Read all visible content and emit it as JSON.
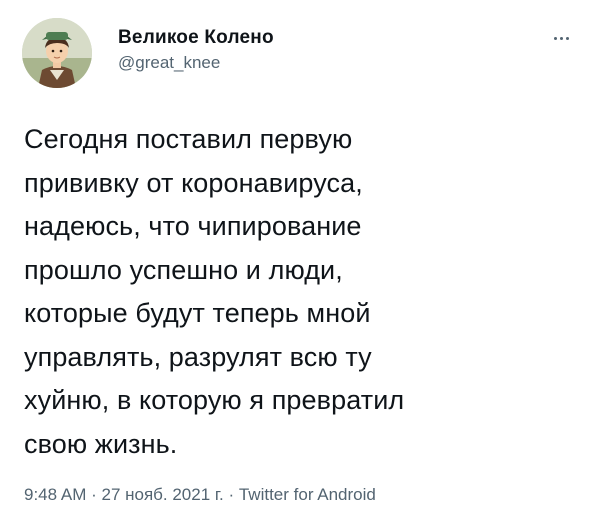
{
  "user": {
    "display_name": "Великое Колено",
    "handle": "@great_knee"
  },
  "menu": {
    "icon": "more-horizontal-icon"
  },
  "tweet": {
    "text": "Сегодня поставил первую\nпрививку от коронавируса,\nнадеюсь, что чипирование\nпрошло успешно и люди,\nкоторые будут теперь мной\nуправлять, разрулят всю ту\nхуйню, в которую я превратил\nсвою жизнь."
  },
  "meta": {
    "time": "9:48 AM",
    "separator": " · ",
    "date": "27 нояб. 2021 г.",
    "source": "Twitter for Android"
  },
  "colors": {
    "text": "#0f1419",
    "secondary": "#536471",
    "background": "#ffffff"
  }
}
